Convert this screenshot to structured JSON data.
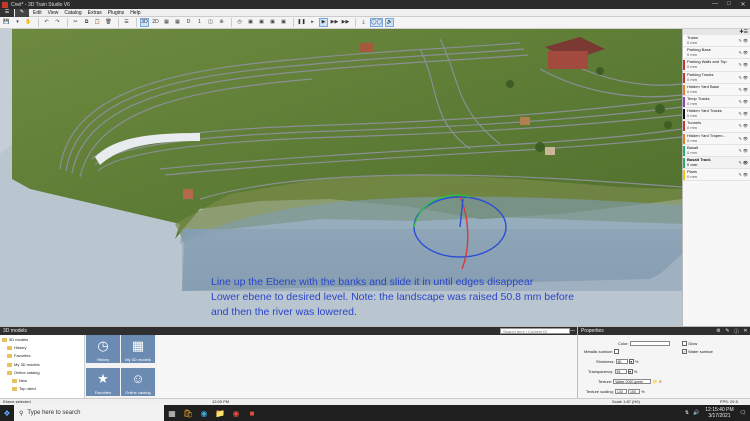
{
  "window": {
    "title": "Cnet* - 3D Train Studio V6"
  },
  "menu": {
    "items": [
      "Edit",
      "View",
      "Catalog",
      "Extras",
      "Plugins",
      "Help"
    ]
  },
  "toolbar": {
    "view_3d": "3D",
    "view_2d": "2D",
    "labels": [
      "D",
      "1"
    ]
  },
  "caption": {
    "lines": [
      "Line up the Ebene with the banks and slide it in until edges disappear",
      "Lower ebene to desired level.   Note:  the landscape was raised 50.8 mm before",
      "and then the river was lowered."
    ]
  },
  "layers": {
    "items": [
      {
        "name": "Trains",
        "value": "0 mm",
        "color": "#ffffff"
      },
      {
        "name": "Parking Base",
        "value": "0 mm",
        "color": "#ffffff"
      },
      {
        "name": "Parking Walls and Top",
        "value": "0 mm",
        "color": "#c0392b"
      },
      {
        "name": "Parking Tracks",
        "value": "0 mm",
        "color": "#c0392b"
      },
      {
        "name": "Hidden Yard Base",
        "value": "0 mm",
        "color": "#e67e22"
      },
      {
        "name": "Temp Tracks",
        "value": "0 mm",
        "color": "#8e44ad"
      },
      {
        "name": "Hidden Yard Tracks",
        "value": "0 mm",
        "color": "#111111"
      },
      {
        "name": "Tunnels",
        "value": "0 mm",
        "color": "#c0392b"
      },
      {
        "name": "Hidden Yard Trapen...",
        "value": "0 mm",
        "color": "#e67e22"
      },
      {
        "name": "Basalt",
        "value": "0 mm",
        "color": "#27ae60"
      },
      {
        "name": "Basalt Track",
        "value": "0 mm",
        "color": "#27ae60"
      },
      {
        "name": "Plans",
        "value": "0 mm",
        "color": "#f1c40f"
      }
    ]
  },
  "catalog": {
    "title": "3D models",
    "search_placeholder": "Search term / Content ID",
    "tree": [
      "3D models",
      "History",
      "Favorites",
      "My 3D models",
      "Online catalog",
      "New",
      "Top rated"
    ],
    "tiles": [
      "History",
      "My 3D models",
      "Favorites",
      "Online catalog"
    ]
  },
  "properties": {
    "title": "Properties",
    "color_label": "Color:",
    "metallic_label": "Metallic surface:",
    "shininess_label": "Shininess:",
    "shininess_value": "80",
    "transparency_label": "Transparency:",
    "transparency_value": "55",
    "texture_label": "Texture:",
    "texture_value": "Water 0030 green",
    "texture_scaling_label": "Texture scaling:",
    "texture_scaling_x": "130",
    "texture_scaling_y": "150",
    "unit_percent": "%",
    "glow_label": "Glow",
    "water_label": "Water surface"
  },
  "status": {
    "left": "Ebene selected",
    "mid": "12:00 PM",
    "scale": "Scale 1:87 (H0)",
    "fps": "FPS: 29.5"
  },
  "taskbar": {
    "search_placeholder": "Type here to search",
    "time": "12:15:40 PM",
    "date": "3/17/2021"
  }
}
